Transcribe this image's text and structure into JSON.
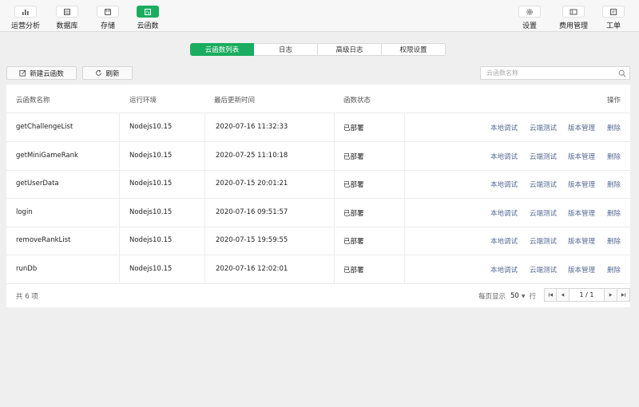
{
  "toolbar": {
    "left": [
      {
        "label": "运营分析",
        "icon": "bar-chart-icon"
      },
      {
        "label": "数据库",
        "icon": "database-icon"
      },
      {
        "label": "存储",
        "icon": "storage-icon"
      },
      {
        "label": "云函数",
        "icon": "cloud-function-icon",
        "active": true
      }
    ],
    "right": [
      {
        "label": "设置",
        "icon": "gear-icon"
      },
      {
        "label": "费用管理",
        "icon": "billing-icon"
      },
      {
        "label": "工单",
        "icon": "ticket-icon"
      }
    ]
  },
  "tabs": [
    "云函数列表",
    "日志",
    "高级日志",
    "权限设置"
  ],
  "actions": {
    "new_label": "新建云函数",
    "refresh_label": "刷新"
  },
  "search": {
    "placeholder": "云函数名称",
    "value": ""
  },
  "table": {
    "headers": {
      "name": "云函数名称",
      "runtime": "运行环境",
      "updated": "最后更新时间",
      "status": "函数状态",
      "ops": "操作"
    },
    "rows": [
      {
        "name": "getChallengeList",
        "runtime": "Nodejs10.15",
        "updated": "2020-07-16 11:32:33",
        "status": "已部署"
      },
      {
        "name": "getMiniGameRank",
        "runtime": "Nodejs10.15",
        "updated": "2020-07-25 11:10:18",
        "status": "已部署"
      },
      {
        "name": "getUserData",
        "runtime": "Nodejs10.15",
        "updated": "2020-07-15 20:01:21",
        "status": "已部署"
      },
      {
        "name": "login",
        "runtime": "Nodejs10.15",
        "updated": "2020-07-16 09:51:57",
        "status": "已部署"
      },
      {
        "name": "removeRankList",
        "runtime": "Nodejs10.15",
        "updated": "2020-07-15 19:59:55",
        "status": "已部署"
      },
      {
        "name": "runDb",
        "runtime": "Nodejs10.15",
        "updated": "2020-07-16 12:02:01",
        "status": "已部署"
      }
    ],
    "row_actions": {
      "local_debug": "本地调试",
      "cloud_test": "云端测试",
      "versions": "版本管理",
      "delete": "删除"
    }
  },
  "footer": {
    "total": "共 6 项",
    "per_page_label": "每页显示",
    "per_page_value": "50",
    "per_page_unit": "行",
    "page_info": "1 / 1"
  },
  "colors": {
    "accent": "#1aad5f",
    "link": "#576b95"
  }
}
